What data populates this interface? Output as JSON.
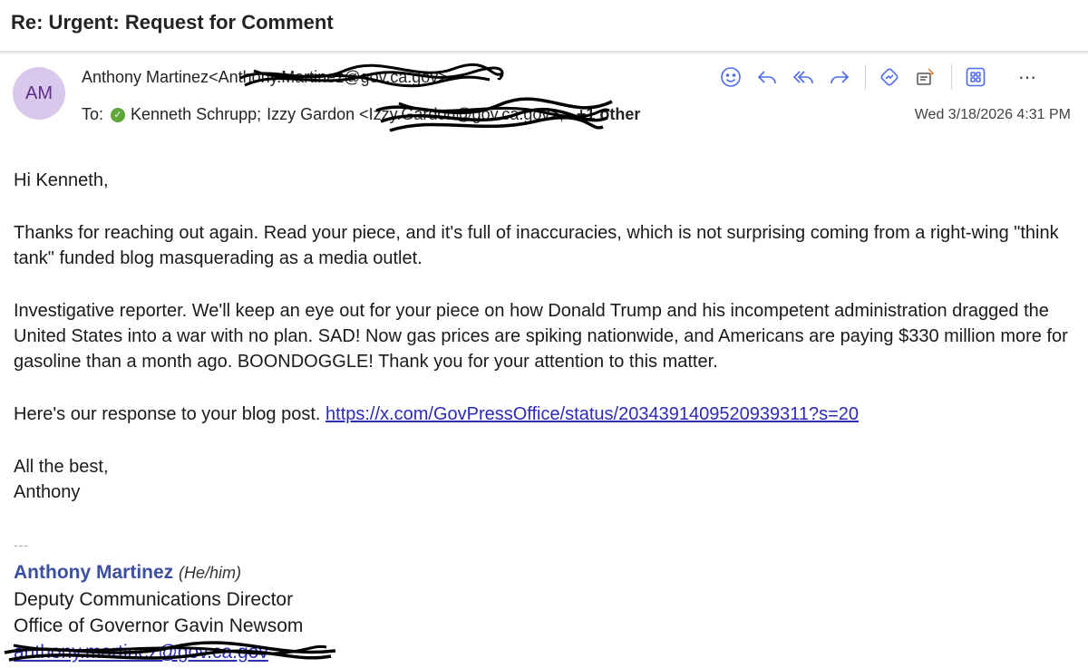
{
  "subject": "Re: Urgent: Request for Comment",
  "sender": {
    "initials": "AM",
    "from_text": "Anthony Martinez<Anthony.Martinez@gov.ca.gov>"
  },
  "recipients": {
    "prefix": "To:",
    "names": [
      "Kenneth Schrupp;",
      "Izzy Gardon <Izzy.Gardon@gov.ca.gov>;"
    ],
    "more": "+1 other"
  },
  "date": "Wed 3/18/2026 4:31 PM",
  "toolbar": {
    "icons": [
      "emoji-icon",
      "reply-icon",
      "reply-all-icon",
      "forward-icon",
      "immersive-reader-icon",
      "summarize-icon",
      "apps-icon",
      "more-icon"
    ],
    "accent": "#4f6bed"
  },
  "body": {
    "greeting": "Hi Kenneth,",
    "p1": "Thanks for reaching out again. Read your piece, and it's full of inaccuracies, which is not surprising coming from a right-wing \"think tank\" funded blog masquerading as a media outlet.",
    "p2": "Investigative reporter. We'll keep an eye out for your piece on how Donald Trump and his incompetent administration dragged the United States into a war with no plan. SAD! Now gas prices are spiking nationwide, and Americans are paying $330 million more for gasoline than a month ago. BOONDOGGLE! Thank you for your attention to this matter.",
    "p3_text": "Here's our response to your blog post. ",
    "p3_link": "https://x.com/GovPressOffice/status/2034391409520939311?s=20",
    "closing": "All the best,",
    "closing_name": "Anthony"
  },
  "signature": {
    "dashes": "---",
    "name": "Anthony Martinez",
    "pronouns": "(He/him)",
    "title": "Deputy Communications Director",
    "office": "Office of Governor Gavin Newsom",
    "email": "anthony.martinez@gov.ca.gov"
  },
  "colors": {
    "avatar_bg": "#d9c7ec",
    "signature_name": "#3c4fa0",
    "link": "#2b2bb8",
    "presence": "#5fa537"
  }
}
